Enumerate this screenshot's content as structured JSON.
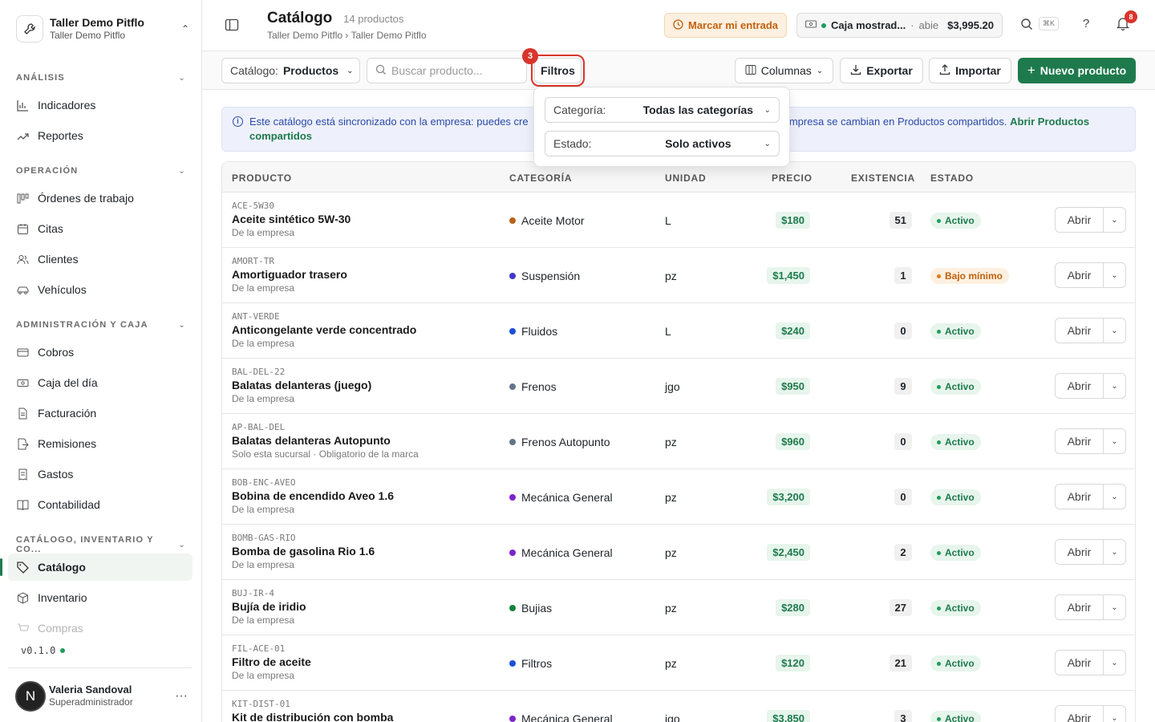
{
  "org": {
    "name": "Taller Demo Pitflo",
    "sub": "Taller Demo Pitflo"
  },
  "sidebar": {
    "sections": [
      {
        "label": "ANÁLISIS"
      },
      {
        "label": "OPERACIÓN"
      },
      {
        "label": "ADMINISTRACIÓN Y CAJA"
      },
      {
        "label": "CATÁLOGO, INVENTARIO Y CO..."
      }
    ],
    "items": [
      {
        "label": "Indicadores",
        "icon": "bar-chart-icon"
      },
      {
        "label": "Reportes",
        "icon": "trend-icon"
      },
      {
        "label": "Órdenes de trabajo",
        "icon": "kanban-icon"
      },
      {
        "label": "Citas",
        "icon": "calendar-icon"
      },
      {
        "label": "Clientes",
        "icon": "users-icon"
      },
      {
        "label": "Vehículos",
        "icon": "car-icon"
      },
      {
        "label": "Cobros",
        "icon": "card-icon"
      },
      {
        "label": "Caja del día",
        "icon": "cash-icon"
      },
      {
        "label": "Facturación",
        "icon": "invoice-icon"
      },
      {
        "label": "Remisiones",
        "icon": "remission-icon"
      },
      {
        "label": "Gastos",
        "icon": "receipt-icon"
      },
      {
        "label": "Contabilidad",
        "icon": "book-icon"
      },
      {
        "label": "Catálogo",
        "icon": "tag-icon"
      },
      {
        "label": "Inventario",
        "icon": "box-icon"
      },
      {
        "label": "Compras",
        "icon": "cart-icon"
      }
    ],
    "version": "v0.1.0"
  },
  "user": {
    "initial": "N",
    "name": "Valeria Sandoval",
    "role": "Superadministrador"
  },
  "header": {
    "title": "Catálogo",
    "count": "14 productos",
    "breadcrumb": "Taller Demo Pitflo › Taller Demo Pitflo",
    "mark_entry": "Marcar mi entrada",
    "caja_name": "Caja mostrad...",
    "caja_sep": "·",
    "caja_status": "abie",
    "caja_amount": "$3,995.20",
    "shortcut": "⌘K",
    "help": "?",
    "notifications": "8"
  },
  "toolbar": {
    "catalog_label": "Catálogo:",
    "catalog_value": "Productos",
    "search_placeholder": "Buscar producto...",
    "filters": "Filtros",
    "filters_badge": "3",
    "columns": "Columnas",
    "export": "Exportar",
    "import": "Importar",
    "new_product": "Nuevo producto"
  },
  "banner": {
    "text_left": "Este catálogo está sincronizado con la empresa: puedes cre",
    "text_right": "empresa se cambian en Productos compartidos.",
    "link_a": "Abrir Productos",
    "link_b": "compartidos"
  },
  "filters_popover": {
    "category_label": "Categoría:",
    "category_value": "Todas las categorías",
    "status_label": "Estado:",
    "status_value": "Solo activos"
  },
  "table": {
    "columns": [
      "PRODUCTO",
      "CATEGORÍA",
      "UNIDAD",
      "PRECIO",
      "EXISTENCIA",
      "ESTADO"
    ],
    "open_label": "Abrir",
    "rows": [
      {
        "sku": "ACE-5W30",
        "name": "Aceite sintético 5W-30",
        "source": "De la empresa",
        "category": "Aceite Motor",
        "cat_color": "#b8621b",
        "unit": "L",
        "price": "$180",
        "stock": "51",
        "status": "Activo",
        "status_kind": "ok"
      },
      {
        "sku": "AMORT-TR",
        "name": "Amortiguador trasero",
        "source": "De la empresa",
        "category": "Suspensión",
        "cat_color": "#4338ca",
        "unit": "pz",
        "price": "$1,450",
        "stock": "1",
        "status": "Bajo mínimo",
        "status_kind": "warn"
      },
      {
        "sku": "ANT-VERDE",
        "name": "Anticongelante verde concentrado",
        "source": "De la empresa",
        "category": "Fluidos",
        "cat_color": "#1d4ed8",
        "unit": "L",
        "price": "$240",
        "stock": "0",
        "status": "Activo",
        "status_kind": "ok"
      },
      {
        "sku": "BAL-DEL-22",
        "name": "Balatas delanteras (juego)",
        "source": "De la empresa",
        "category": "Frenos",
        "cat_color": "#64748b",
        "unit": "jgo",
        "price": "$950",
        "stock": "9",
        "status": "Activo",
        "status_kind": "ok"
      },
      {
        "sku": "AP-BAL-DEL",
        "name": "Balatas delanteras Autopunto",
        "source": "Solo esta sucursal · Obligatorio de la marca",
        "category": "Frenos Autopunto",
        "cat_color": "#64748b",
        "unit": "pz",
        "price": "$960",
        "stock": "0",
        "status": "Activo",
        "status_kind": "ok"
      },
      {
        "sku": "BOB-ENC-AVEO",
        "name": "Bobina de encendido Aveo 1.6",
        "source": "De la empresa",
        "category": "Mecánica General",
        "cat_color": "#7e22ce",
        "unit": "pz",
        "price": "$3,200",
        "stock": "0",
        "status": "Activo",
        "status_kind": "ok"
      },
      {
        "sku": "BOMB-GAS-RIO",
        "name": "Bomba de gasolina Rio 1.6",
        "source": "De la empresa",
        "category": "Mecánica General",
        "cat_color": "#7e22ce",
        "unit": "pz",
        "price": "$2,450",
        "stock": "2",
        "status": "Activo",
        "status_kind": "ok"
      },
      {
        "sku": "BUJ-IR-4",
        "name": "Bujía de iridio",
        "source": "De la empresa",
        "category": "Bujias",
        "cat_color": "#15803d",
        "unit": "pz",
        "price": "$280",
        "stock": "27",
        "status": "Activo",
        "status_kind": "ok"
      },
      {
        "sku": "FIL-ACE-01",
        "name": "Filtro de aceite",
        "source": "De la empresa",
        "category": "Filtros",
        "cat_color": "#1d4ed8",
        "unit": "pz",
        "price": "$120",
        "stock": "21",
        "status": "Activo",
        "status_kind": "ok"
      },
      {
        "sku": "KIT-DIST-01",
        "name": "Kit de distribución con bomba",
        "source": "",
        "category": "Mecánica General",
        "cat_color": "#7e22ce",
        "unit": "jgo",
        "price": "$3,850",
        "stock": "3",
        "status": "Activo",
        "status_kind": "ok"
      }
    ]
  },
  "colors": {
    "accent": "#1e7a4c",
    "danger": "#d9342b",
    "warning": "#c2610f",
    "info": "#2b4aa8"
  }
}
